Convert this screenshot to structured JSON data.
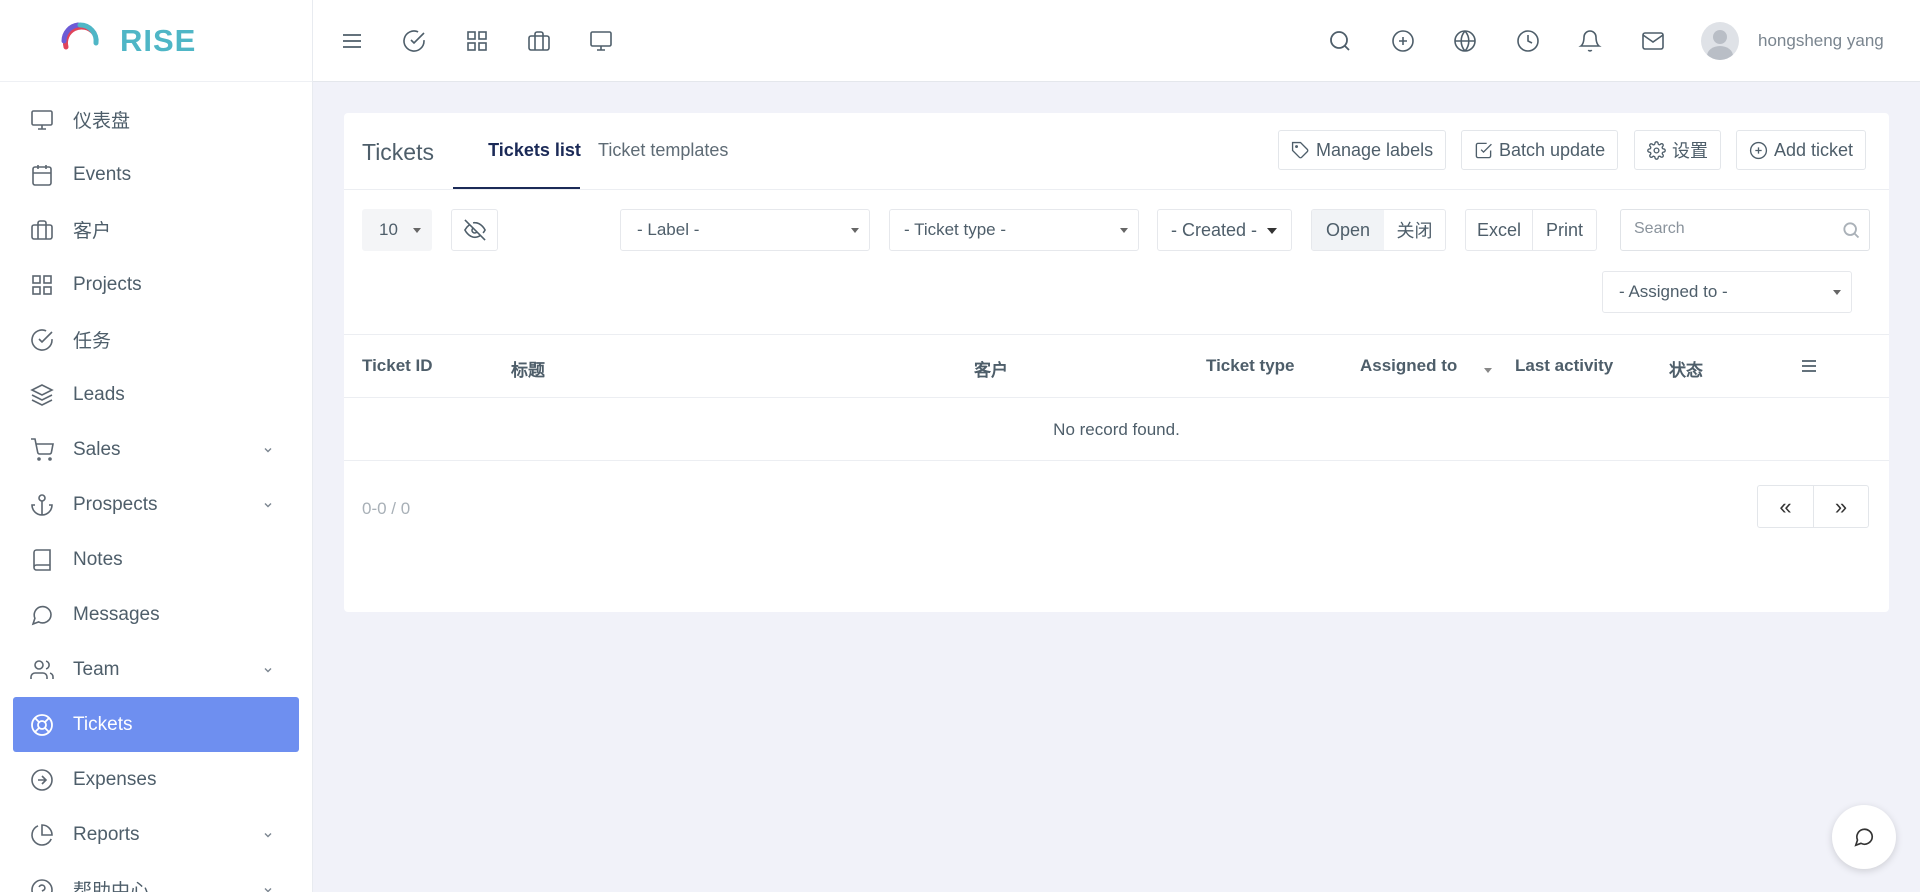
{
  "brand": {
    "name": "RISE"
  },
  "sidebar": {
    "items": [
      {
        "label": "仪表盘",
        "icon": "monitor-icon",
        "has_submenu": false
      },
      {
        "label": "Events",
        "icon": "calendar-icon",
        "has_submenu": false
      },
      {
        "label": "客户",
        "icon": "briefcase-icon",
        "has_submenu": false
      },
      {
        "label": "Projects",
        "icon": "grid-icon",
        "has_submenu": false
      },
      {
        "label": "任务",
        "icon": "check-circle-icon",
        "has_submenu": false
      },
      {
        "label": "Leads",
        "icon": "layers-icon",
        "has_submenu": false
      },
      {
        "label": "Sales",
        "icon": "cart-icon",
        "has_submenu": true
      },
      {
        "label": "Prospects",
        "icon": "anchor-icon",
        "has_submenu": true
      },
      {
        "label": "Notes",
        "icon": "book-icon",
        "has_submenu": false
      },
      {
        "label": "Messages",
        "icon": "message-icon",
        "has_submenu": false
      },
      {
        "label": "Team",
        "icon": "users-icon",
        "has_submenu": true
      },
      {
        "label": "Tickets",
        "icon": "lifebuoy-icon",
        "has_submenu": false,
        "active": true
      },
      {
        "label": "Expenses",
        "icon": "arrow-circle-icon",
        "has_submenu": false
      },
      {
        "label": "Reports",
        "icon": "pie-chart-icon",
        "has_submenu": true
      },
      {
        "label": "帮助中心",
        "icon": "help-icon",
        "has_submenu": true
      }
    ]
  },
  "topbar": {
    "icons": [
      "menu-icon",
      "check-circle-icon",
      "grid-icon",
      "briefcase-icon",
      "monitor-icon",
      "search-icon",
      "plus-circle-icon",
      "globe-icon",
      "clock-icon",
      "bell-icon",
      "mail-icon"
    ],
    "user_name": "hongsheng yang"
  },
  "page": {
    "title": "Tickets",
    "tabs": [
      {
        "label": "Tickets list",
        "active": true
      },
      {
        "label": "Ticket templates",
        "active": false
      }
    ],
    "actions": {
      "manage_labels": "Manage labels",
      "batch_update": "Batch update",
      "settings": "设置",
      "add_ticket": "Add ticket"
    }
  },
  "filters": {
    "page_size": "10",
    "label": "- Label -",
    "ticket_type": "- Ticket type -",
    "created": "- Created -",
    "status_open": "Open",
    "status_closed": "关闭",
    "excel": "Excel",
    "print": "Print",
    "search_placeholder": "Search",
    "assigned_to": "- Assigned to -"
  },
  "table": {
    "columns": [
      "Ticket ID",
      "标题",
      "客户",
      "Ticket type",
      "Assigned to",
      "Last activity",
      "状态"
    ],
    "empty_message": "No record found.",
    "range": "0-0 / 0",
    "prev_label": "«",
    "next_label": "»"
  },
  "colors": {
    "brand": "#4fb6c6",
    "active_menu": "#6e8ff0",
    "active_tab": "#1b2a57",
    "background": "#f1f2f9"
  }
}
